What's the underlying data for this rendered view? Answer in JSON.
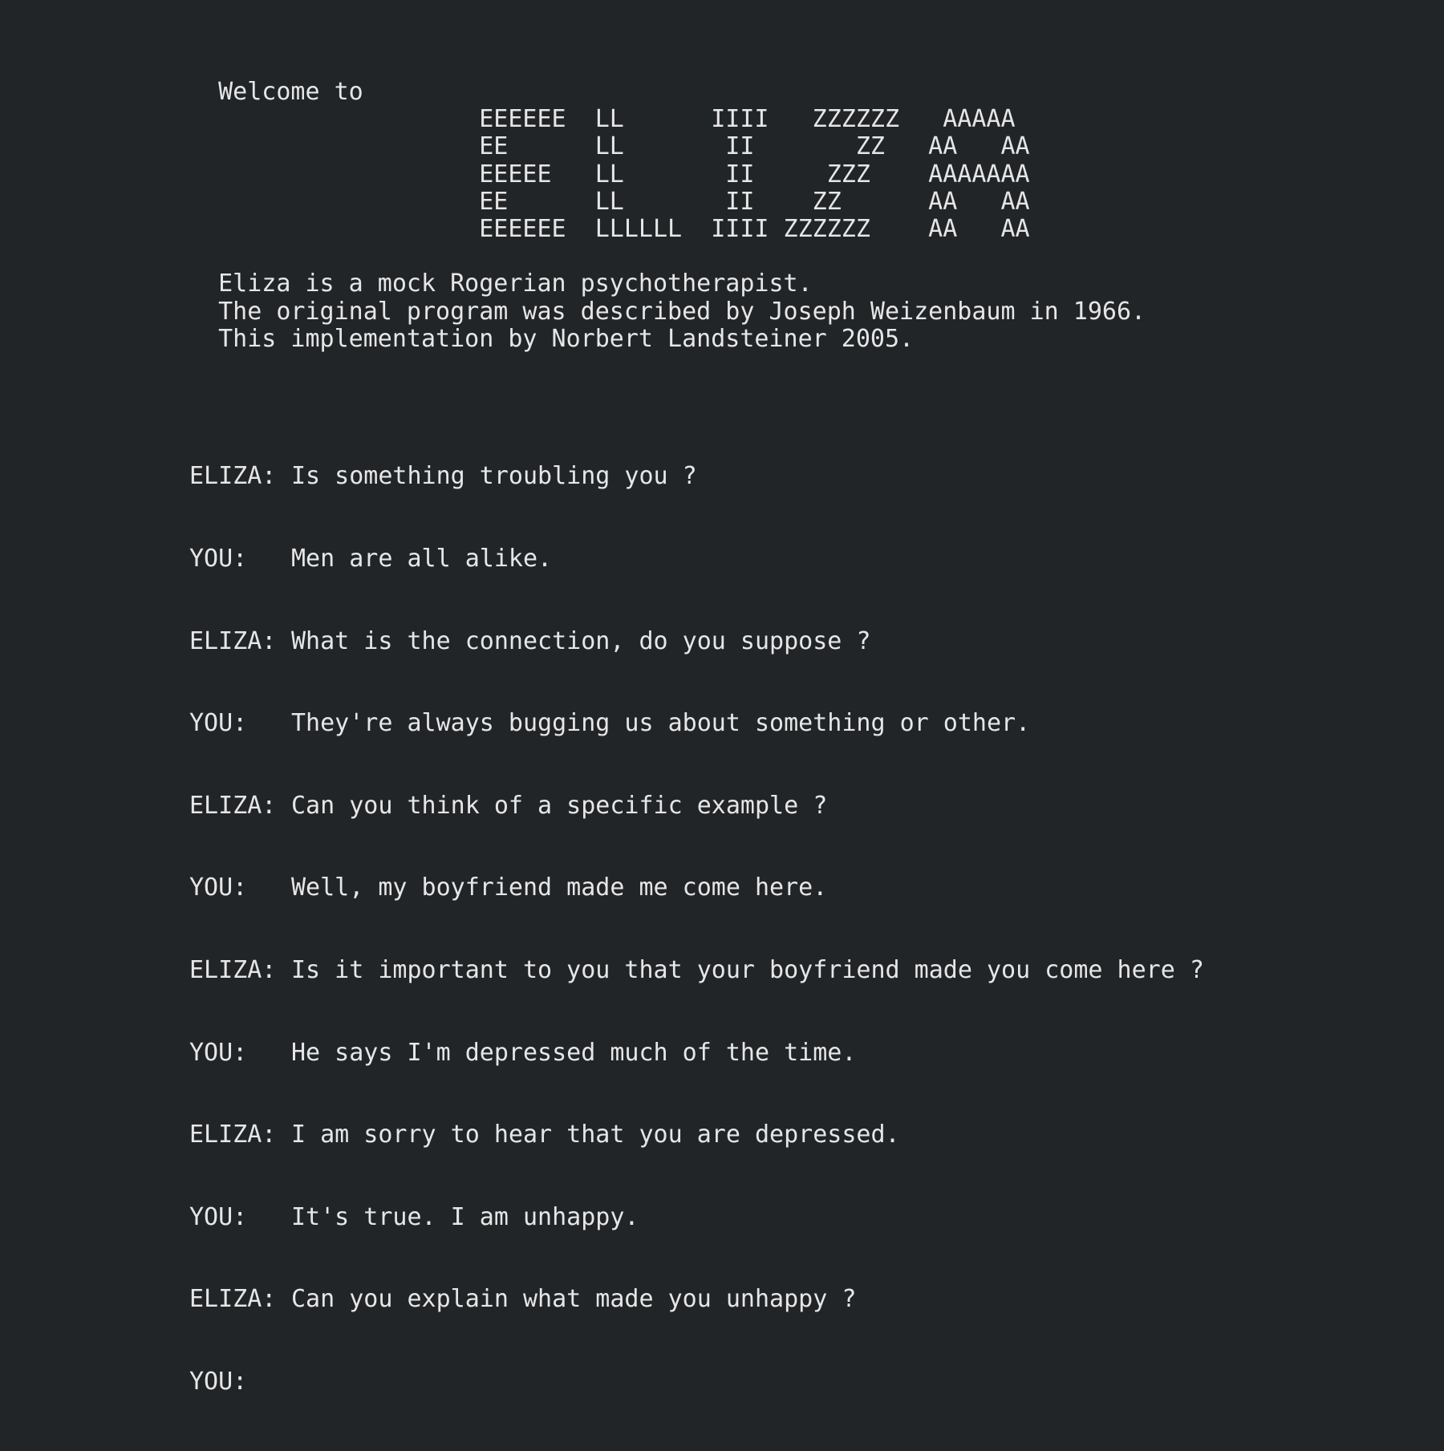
{
  "banner": {
    "welcome": "  Welcome to",
    "logo_lines": [
      "                    EEEEEE  LL      IIII   ZZZZZZ   AAAAA",
      "                    EE      LL       II       ZZ   AA   AA",
      "                    EEEEE   LL       II     ZZZ    AAAAAAA",
      "                    EE      LL       II    ZZ      AA   AA",
      "                    EEEEEE  LLLLLL  IIII ZZZZZZ    AA   AA"
    ],
    "info_lines": [
      "  Eliza is a mock Rogerian psychotherapist.",
      "  The original program was described by Joseph Weizenbaum in 1966.",
      "  This implementation by Norbert Landsteiner 2005."
    ]
  },
  "transcript": [
    {
      "speaker": "ELIZA:",
      "text": "Is something troubling you ?"
    },
    {
      "speaker": "YOU:",
      "text": "Men are all alike."
    },
    {
      "speaker": "ELIZA:",
      "text": "What is the connection, do you suppose ?"
    },
    {
      "speaker": "YOU:",
      "text": "They're always bugging us about something or other."
    },
    {
      "speaker": "ELIZA:",
      "text": "Can you think of a specific example ?"
    },
    {
      "speaker": "YOU:",
      "text": "Well, my boyfriend made me come here."
    },
    {
      "speaker": "ELIZA:",
      "text": "Is it important to you that your boyfriend made you come here ?"
    },
    {
      "speaker": "YOU:",
      "text": "He says I'm depressed much of the time."
    },
    {
      "speaker": "ELIZA:",
      "text": "I am sorry to hear that you are depressed."
    },
    {
      "speaker": "YOU:",
      "text": "It's true. I am unhappy."
    },
    {
      "speaker": "ELIZA:",
      "text": "Can you explain what made you unhappy ?"
    }
  ],
  "prompt": {
    "speaker": "YOU:",
    "value": ""
  },
  "colors": {
    "background": "#222528",
    "text": "#e6e6e6"
  }
}
